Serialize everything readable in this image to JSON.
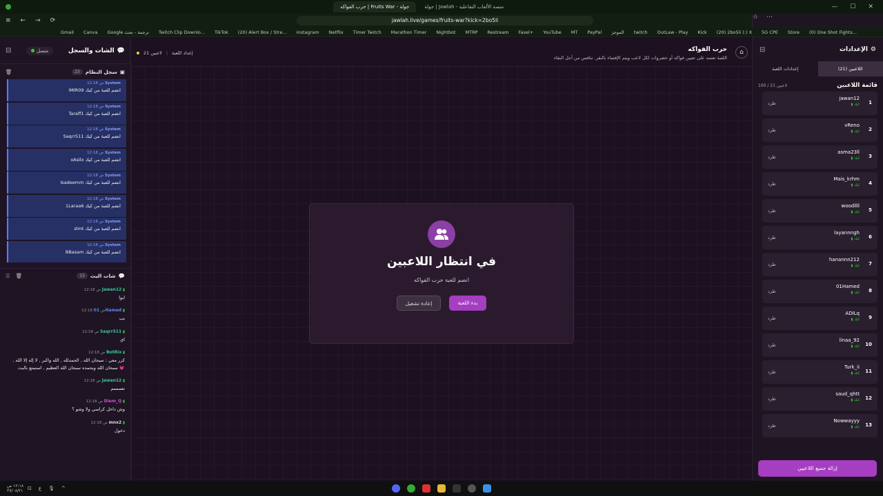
{
  "browser": {
    "tabs": [
      "جولة | Jawlah - منصة الألعاب التفاعلية",
      "حرب الفواكه | Fruits War - جولة"
    ],
    "url": "jawlah.live/games/fruits-war?kick=2bo5li",
    "bookmarks": [
      "Gmail",
      "Canva",
      "Google ترجمة - بحث",
      "Twitch Clip Downlo...",
      "TikTok",
      "(20) Alert Box / Stre...",
      "instagram",
      "Netflix",
      "Timer Twitch",
      "Marathon Timer",
      "Nightbot",
      "MTRP",
      "Restream",
      "Fasel+",
      "YouTube",
      "MT",
      "PayPal",
      "الموجز",
      "twitch",
      "OutLaw - Play",
      "Kick",
      "(20) 2bo5li (:) X",
      "5G CPE",
      "Store",
      "(0) One Shot Fights..."
    ]
  },
  "chat": {
    "title": "الشات والسجل",
    "connection": "متصل",
    "system_log": {
      "title": "سجل النظام",
      "count": "23",
      "messages": [
        {
          "user": "System",
          "time": "12:18 ص",
          "text": "iMIR09 انضم للعبة من كيك"
        },
        {
          "user": "System",
          "time": "12:18 ص",
          "text": "Taraff1 انضم للعبة من كيك"
        },
        {
          "user": "System",
          "time": "12:18 ص",
          "text": "Saqrr511 انضم للعبة من كيك"
        },
        {
          "user": "System",
          "time": "12:18 ص",
          "text": "xAsilx انضم للعبة من كيك"
        },
        {
          "user": "System",
          "time": "12:18 ص",
          "text": "Isadeemm انضم للعبة من كيك"
        },
        {
          "user": "System",
          "time": "12:18 ص",
          "text": "1Laraa6 انضم للعبة من كيك"
        },
        {
          "user": "System",
          "time": "12:18 ص",
          "text": "slmt انضم للعبة من كيك"
        },
        {
          "user": "System",
          "time": "12:18 ص",
          "text": "BBasam انضم للعبة من كيك"
        }
      ]
    },
    "live_chat": {
      "title": "شات البث",
      "count": "15",
      "messages": [
        {
          "user": "Jawan12",
          "time": "12:18 ص",
          "text": "ايوا",
          "color": "#3c9"
        },
        {
          "user": "01Hamed",
          "time": "12:18 ص",
          "text": "يب",
          "color": "#58f"
        },
        {
          "user": "Saqrr511",
          "time": "12:18 ص",
          "text": "اي",
          "color": "#3c9"
        },
        {
          "user": "BotRix",
          "time": "12:18 ص",
          "text": "كرر معي : سبحان الله , الحمدلله , الله واكبر , لا إله إلا الله , سبحان الله وبحمده سبحان الله العظيم , استمتع بالبث 💗",
          "color": "#3c9"
        },
        {
          "user": "Jawan12",
          "time": "12:18 ص",
          "text": "نعمممم",
          "color": "#3c9"
        },
        {
          "user": "Diem_Q",
          "time": "12:18 ص",
          "text": "وش داخل كراسي ولا وشو ؟",
          "color": "#c5c"
        },
        {
          "user": "mnx2",
          "time": "12:18 ص",
          "text": "دخول",
          "color": "#ddd"
        }
      ]
    }
  },
  "game": {
    "title": "حرب الفواكه",
    "description": "اللعبة تعتمد على تعيين فواكه أو خضروات لكل لاعب ويتم الإقصاء بالنقر. تنافس من أجل البقاء",
    "players_count": "21 لاعبين",
    "game_settings_link": "إعداد اللعبة",
    "waiting_title": "في انتظار اللاعبين",
    "waiting_sub": "انضم للعبة حرب الفواكه",
    "start_button": "بدء اللعبة",
    "restart_button": "إعادة تشغيل"
  },
  "settings": {
    "title": "الإعدادات",
    "tabs": [
      "اللاعبين (21)",
      "إعدادات اللعبة"
    ],
    "list_title": "قائمة اللاعبين",
    "list_count": "100 / 21 لاعبين",
    "kick_label": "طرد",
    "source_label": "كيك",
    "players": [
      {
        "num": "1",
        "name": "jawan12"
      },
      {
        "num": "2",
        "name": "vReno"
      },
      {
        "num": "3",
        "name": "asma23ll"
      },
      {
        "num": "4",
        "name": "Mais_krhm"
      },
      {
        "num": "5",
        "name": "woodllll"
      },
      {
        "num": "6",
        "name": "layannngh"
      },
      {
        "num": "7",
        "name": "hanannn212"
      },
      {
        "num": "8",
        "name": "01Hamed"
      },
      {
        "num": "9",
        "name": "ADILq"
      },
      {
        "num": "10",
        "name": "linaa_92"
      },
      {
        "num": "11",
        "name": "Turk_ii"
      },
      {
        "num": "12",
        "name": "saud_qhtt"
      },
      {
        "num": "13",
        "name": "Nowwayyy"
      }
    ],
    "remove_all": "إزالة جميع اللاعبين"
  },
  "taskbar": {
    "clock": "١٢:١٨ ص",
    "date": "٢٧/٠٨/٢١",
    "lang": "ع"
  },
  "colors": {
    "accent": "#a53ec0",
    "system_msg_bg": "#263064",
    "kick_green": "#33cc33"
  }
}
